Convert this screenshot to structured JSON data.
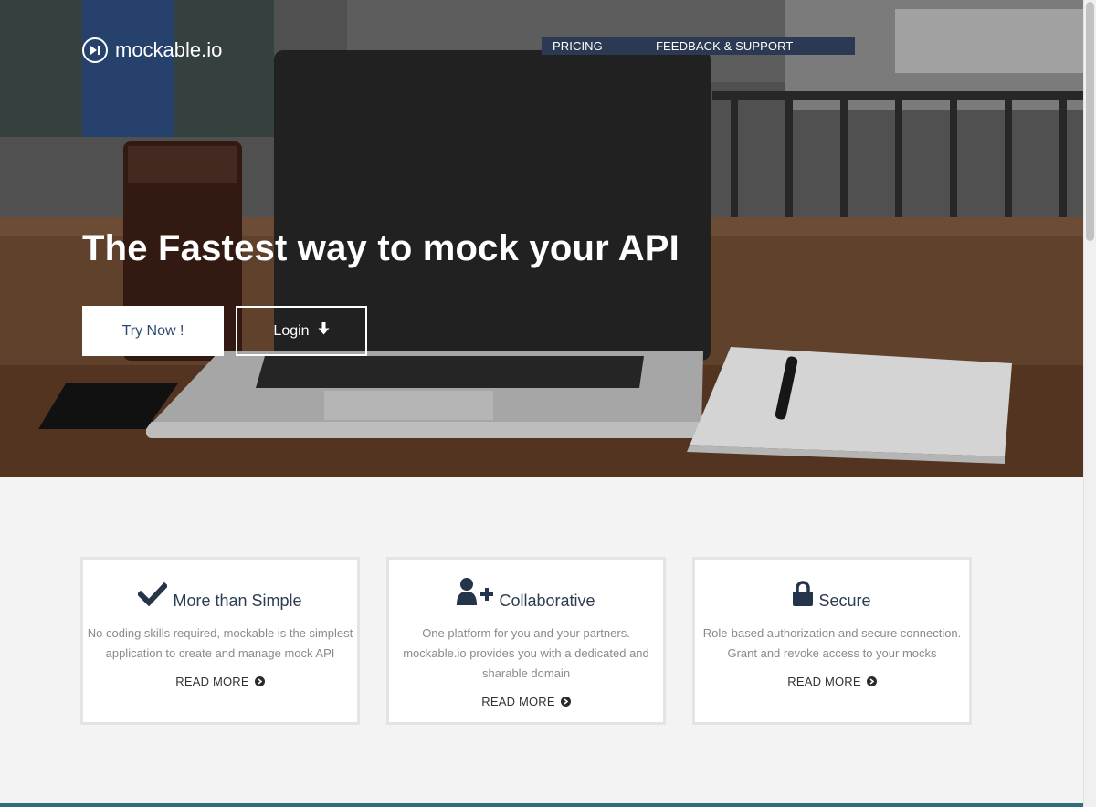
{
  "header": {
    "logo_text": "mockable.io",
    "nav": [
      {
        "label": "PRICING"
      },
      {
        "label": "FEEDBACK & SUPPORT"
      }
    ]
  },
  "hero": {
    "title": "The Fastest way to mock your API",
    "try_label": "Try Now !",
    "login_label": "Login"
  },
  "features": [
    {
      "icon": "checkmark-icon",
      "title": "More than Simple",
      "text": "No coding skills required, mockable is the simplest application to create and manage mock API",
      "read_more": "READ MORE"
    },
    {
      "icon": "add-user-icon",
      "title": "Collaborative",
      "text": "One platform for you and your partners. mockable.io provides you with a dedicated and sharable domain",
      "read_more": "READ MORE"
    },
    {
      "icon": "lock-icon",
      "title": "Secure",
      "text": "Role-based authorization and secure connection. Grant and revoke access to your mocks",
      "read_more": "READ MORE"
    }
  ],
  "colors": {
    "nav_bg": "#2b3a52",
    "title_dark": "#2d3e50",
    "accent_bar": "#2f6f78"
  }
}
